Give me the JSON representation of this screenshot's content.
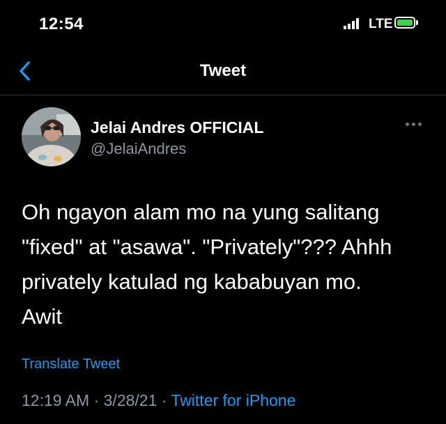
{
  "status_bar": {
    "time": "12:54",
    "network": "LTE"
  },
  "nav": {
    "title": "Tweet"
  },
  "author": {
    "display_name": "Jelai Andres OFFICIAL",
    "handle": "@JelaiAndres"
  },
  "tweet": {
    "text": "Oh ngayon alam mo na yung salitang\n\"fixed\" at \"asawa\". \"Privately\"??? Ahhh\nprivately katulad ng kababuyan mo.\nAwit",
    "translate_label": "Translate Tweet",
    "time": "12:19 AM",
    "separator1": " · ",
    "date": "3/28/21",
    "separator2": " · ",
    "source": "Twitter for iPhone"
  },
  "colors": {
    "accent": "#1d9bf0",
    "secondary_text": "#8b98a5",
    "background": "#000000",
    "battery": "#3ed34a"
  }
}
